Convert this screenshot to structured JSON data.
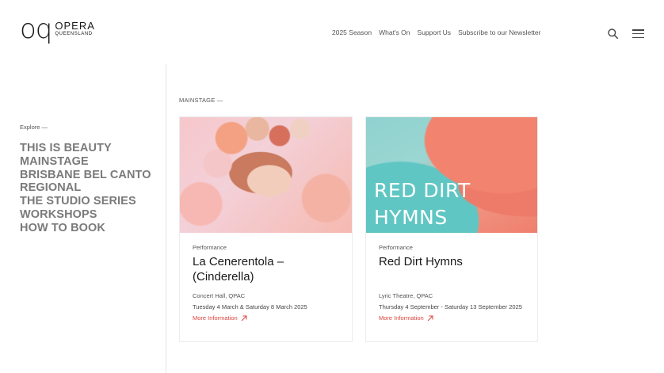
{
  "header": {
    "logo_mark": "oq",
    "logo_line1": "OPERA",
    "logo_line2": "QUEENSLAND",
    "nav": [
      "2025 Season",
      "What's On",
      "Support Us",
      "Subscribe to our Newsletter"
    ]
  },
  "sidebar": {
    "label": "Explore —",
    "items": [
      "THIS IS BEAUTY",
      "MAINSTAGE",
      "BRISBANE BEL CANTO",
      "REGIONAL",
      "THE STUDIO SERIES",
      "WORKSHOPS",
      "HOW TO BOOK"
    ]
  },
  "main": {
    "section_label": "MAINSTAGE —",
    "cards": [
      {
        "category": "Performance",
        "title": "La Cenerentola – (Cinderella)",
        "venue": "Concert Hall, QPAC",
        "dates": "Tuesday 4 March & Saturday 8 March 2025",
        "link": "More Information",
        "image_text": ""
      },
      {
        "category": "Performance",
        "title": "Red Dirt Hymns",
        "venue": "Lyric Theatre, QPAC",
        "dates": "Thursday 4 September - Saturday 13 September 2025",
        "link": "More Information",
        "image_text": "RED DIRT HYMNS"
      }
    ]
  },
  "colors": {
    "accent": "#d9443d",
    "sidebar_text": "#7a7a7a"
  }
}
